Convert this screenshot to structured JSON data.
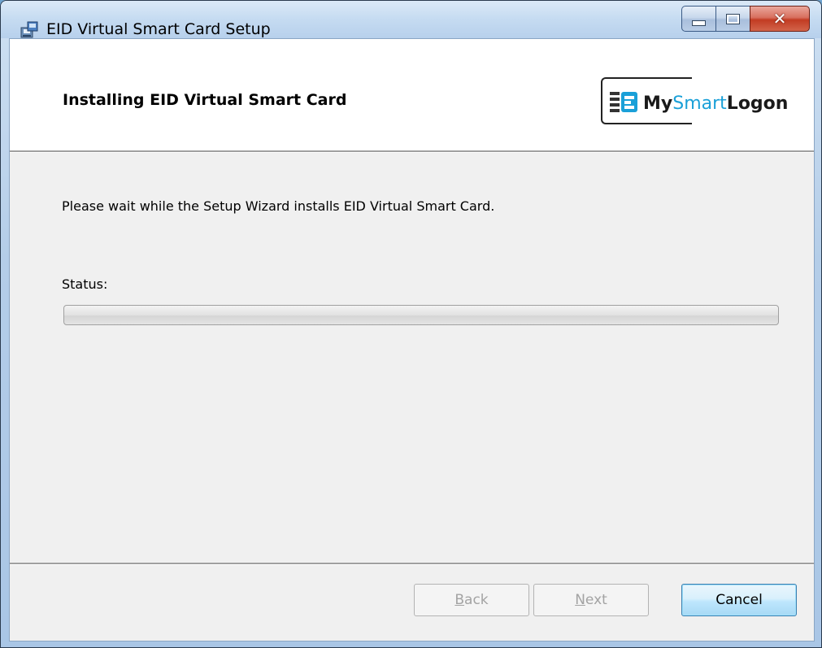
{
  "window": {
    "title": "EID Virtual Smart Card Setup",
    "icon": "installer-icon",
    "caption_buttons": [
      "minimize-icon",
      "maximize-icon",
      "close-icon"
    ]
  },
  "banner": {
    "title": "Installing EID Virtual Smart Card",
    "logo": {
      "part1": "My",
      "part2": "Smart",
      "part3": "Logon"
    }
  },
  "body": {
    "message": "Please wait while the Setup Wizard installs EID Virtual Smart Card.",
    "status_label": "Status:",
    "progress": 0
  },
  "buttons": {
    "back": {
      "accel": "B",
      "rest": "ack"
    },
    "next": {
      "accel": "N",
      "rest": "ext"
    },
    "cancel": "Cancel"
  },
  "colors": {
    "logo_accent": "#1aa0d8",
    "cancel_border": "#3c7fb1",
    "close_button": "#c23b22"
  }
}
